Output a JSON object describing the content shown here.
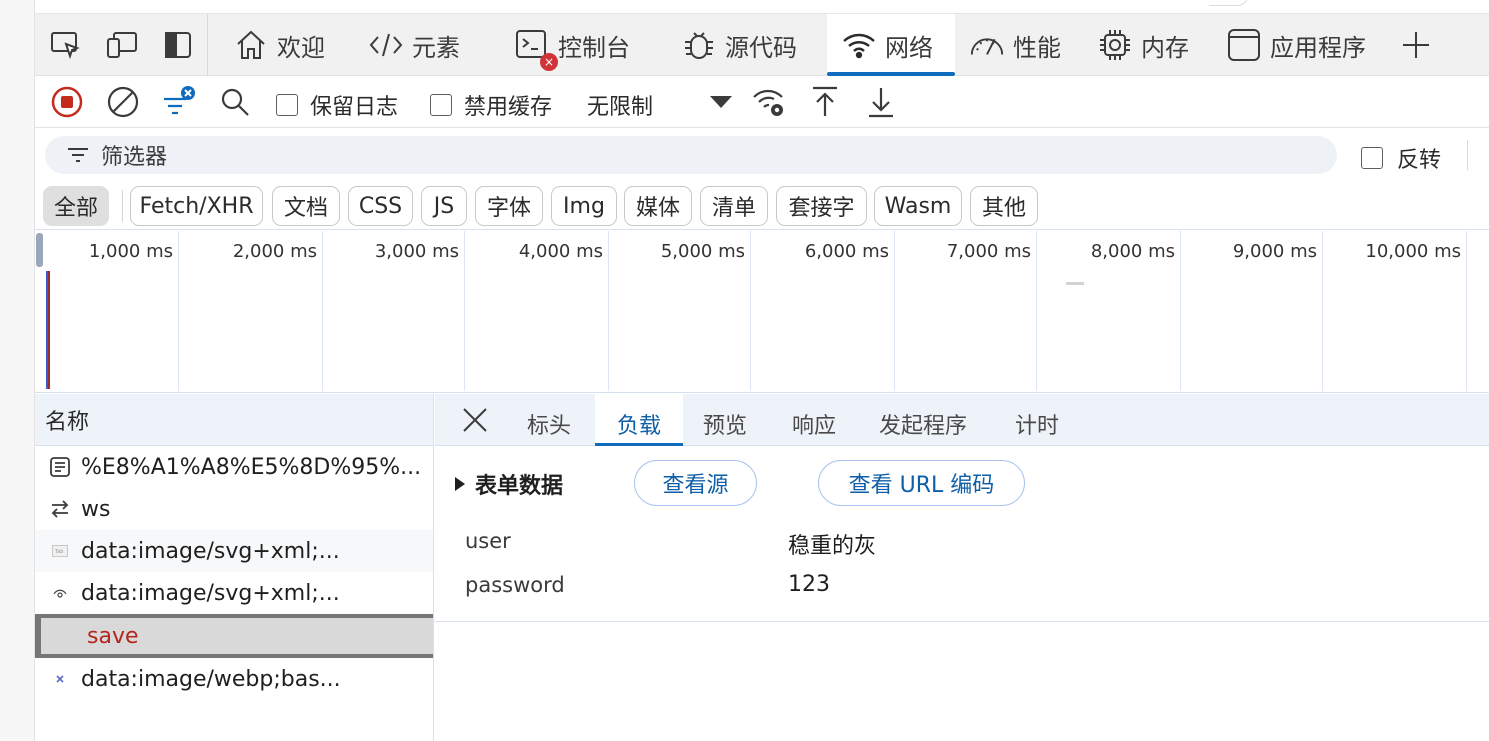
{
  "main_tabs": [
    {
      "label": "欢迎",
      "icon": "home-icon"
    },
    {
      "label": "元素",
      "icon": "code-icon"
    },
    {
      "label": "控制台",
      "icon": "console-icon"
    },
    {
      "label": "源代码",
      "icon": "bug-icon"
    },
    {
      "label": "网络",
      "icon": "wifi-icon",
      "active": true
    },
    {
      "label": "性能",
      "icon": "gauge-icon"
    },
    {
      "label": "内存",
      "icon": "chip-icon"
    },
    {
      "label": "应用程序",
      "icon": "app-window-icon"
    }
  ],
  "toolbar": {
    "preserve_log_label": "保留日志",
    "disable_cache_label": "禁用缓存",
    "throttle_value": "无限制"
  },
  "filter": {
    "placeholder": "筛选器",
    "invert_label": "反转"
  },
  "type_filters": [
    "全部",
    "Fetch/XHR",
    "文档",
    "CSS",
    "JS",
    "字体",
    "Img",
    "媒体",
    "清单",
    "套接字",
    "Wasm",
    "其他"
  ],
  "timeline": {
    "ticks": [
      "1,000 ms",
      "2,000 ms",
      "3,000 ms",
      "4,000 ms",
      "5,000 ms",
      "6,000 ms",
      "7,000 ms",
      "8,000 ms",
      "9,000 ms",
      "10,000 ms"
    ]
  },
  "requests": {
    "header": "名称",
    "rows": [
      {
        "name": "%E8%A1%A8%E5%8D%95%...",
        "icon": "document-icon"
      },
      {
        "name": "ws",
        "icon": "websocket-icon"
      },
      {
        "name": "data:image/svg+xml;...",
        "icon": "image-thumb-icon"
      },
      {
        "name": "data:image/svg+xml;...",
        "icon": "eye-icon"
      },
      {
        "name": "save",
        "icon": "",
        "selected": true
      },
      {
        "name": "data:image/webp;bas...",
        "icon": "image-thumb-icon"
      }
    ]
  },
  "detail": {
    "tabs": [
      "标头",
      "负载",
      "预览",
      "响应",
      "发起程序",
      "计时"
    ],
    "active_tab": "负载",
    "form_section_title": "表单数据",
    "view_source_label": "查看源",
    "view_url_encoded_label": "查看 URL 编码",
    "form_fields": [
      {
        "key": "user",
        "value": "稳重的灰"
      },
      {
        "key": "password",
        "value": "123"
      }
    ]
  },
  "colors": {
    "accent": "#0f6cbd",
    "record_red": "#c42b1c",
    "selected_text": "#b3261e"
  }
}
